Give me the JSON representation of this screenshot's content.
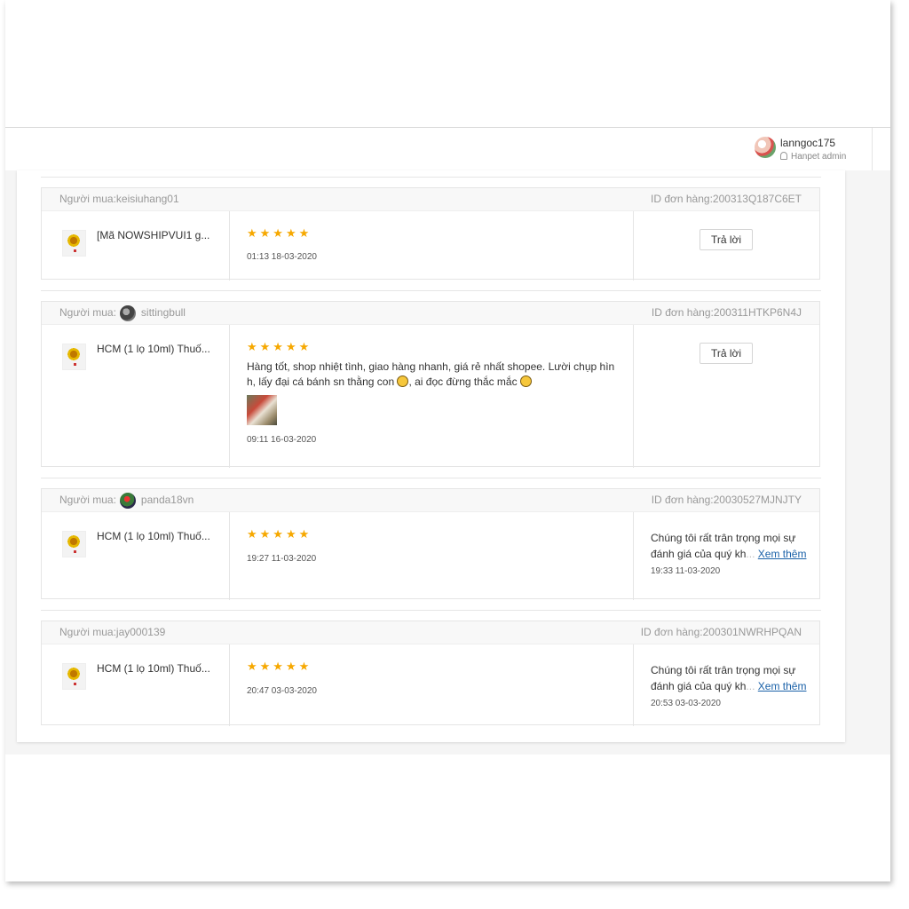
{
  "header": {
    "username": "lanngoc175",
    "role": "Hanpet admin"
  },
  "reviews": [
    {
      "buyer_label": "Người mua:",
      "buyer_name": "keisiuhang01",
      "order_id": "ID đơn hàng:200313Q187C6ET",
      "product_name": "[Mã NOWSHIPVUI1 g...",
      "rating": 5,
      "stars": "★★★★★",
      "comment": "",
      "time": "01:13 18-03-2020",
      "reply_button": "Trả lời"
    },
    {
      "buyer_label": "Người mua:",
      "buyer_name": "sittingbull",
      "order_id": "ID đơn hàng:200311HTKP6N4J",
      "product_name": "HCM (1 lọ 10ml) Thuố...",
      "rating": 5,
      "stars": "★★★★★",
      "comment_part1": "Hàng tốt, shop nhiệt tình, giao hàng nhanh, giá rẻ nhất shopee. Lười chụp hìn h, lấy đại cá bánh sn thằng con",
      "comment_part2": ", ai đọc đừng thắc mắc",
      "time": "09:11 16-03-2020",
      "reply_button": "Trả lời"
    },
    {
      "buyer_label": "Người mua:",
      "buyer_name": "panda18vn",
      "order_id": "ID đơn hàng:20030527MJNJTY",
      "product_name": "HCM (1 lọ 10ml) Thuố...",
      "rating": 5,
      "stars": "★★★★★",
      "time": "19:27 11-03-2020",
      "reply_line1": "Chúng tôi rất trân trọng mọi sự",
      "reply_line2": "đánh giá của quý kh",
      "reply_faded": "...",
      "see_more": "Xem thêm",
      "reply_time": "19:33 11-03-2020"
    },
    {
      "buyer_label": "Người mua:",
      "buyer_name": "jay000139",
      "order_id": "ID đơn hàng:200301NWRHPQAN",
      "product_name": "HCM (1 lọ 10ml) Thuố...",
      "rating": 5,
      "stars": "★★★★★",
      "time": "20:47 03-03-2020",
      "reply_line1": "Chúng tôi rất trân trọng mọi sự",
      "reply_line2": "đánh giá của quý kh",
      "reply_faded": "...",
      "see_more": "Xem thêm",
      "reply_time": "20:53 03-03-2020"
    }
  ],
  "colors": {
    "star": "#f6a800",
    "link": "#1a61a8",
    "muted": "#999999"
  }
}
